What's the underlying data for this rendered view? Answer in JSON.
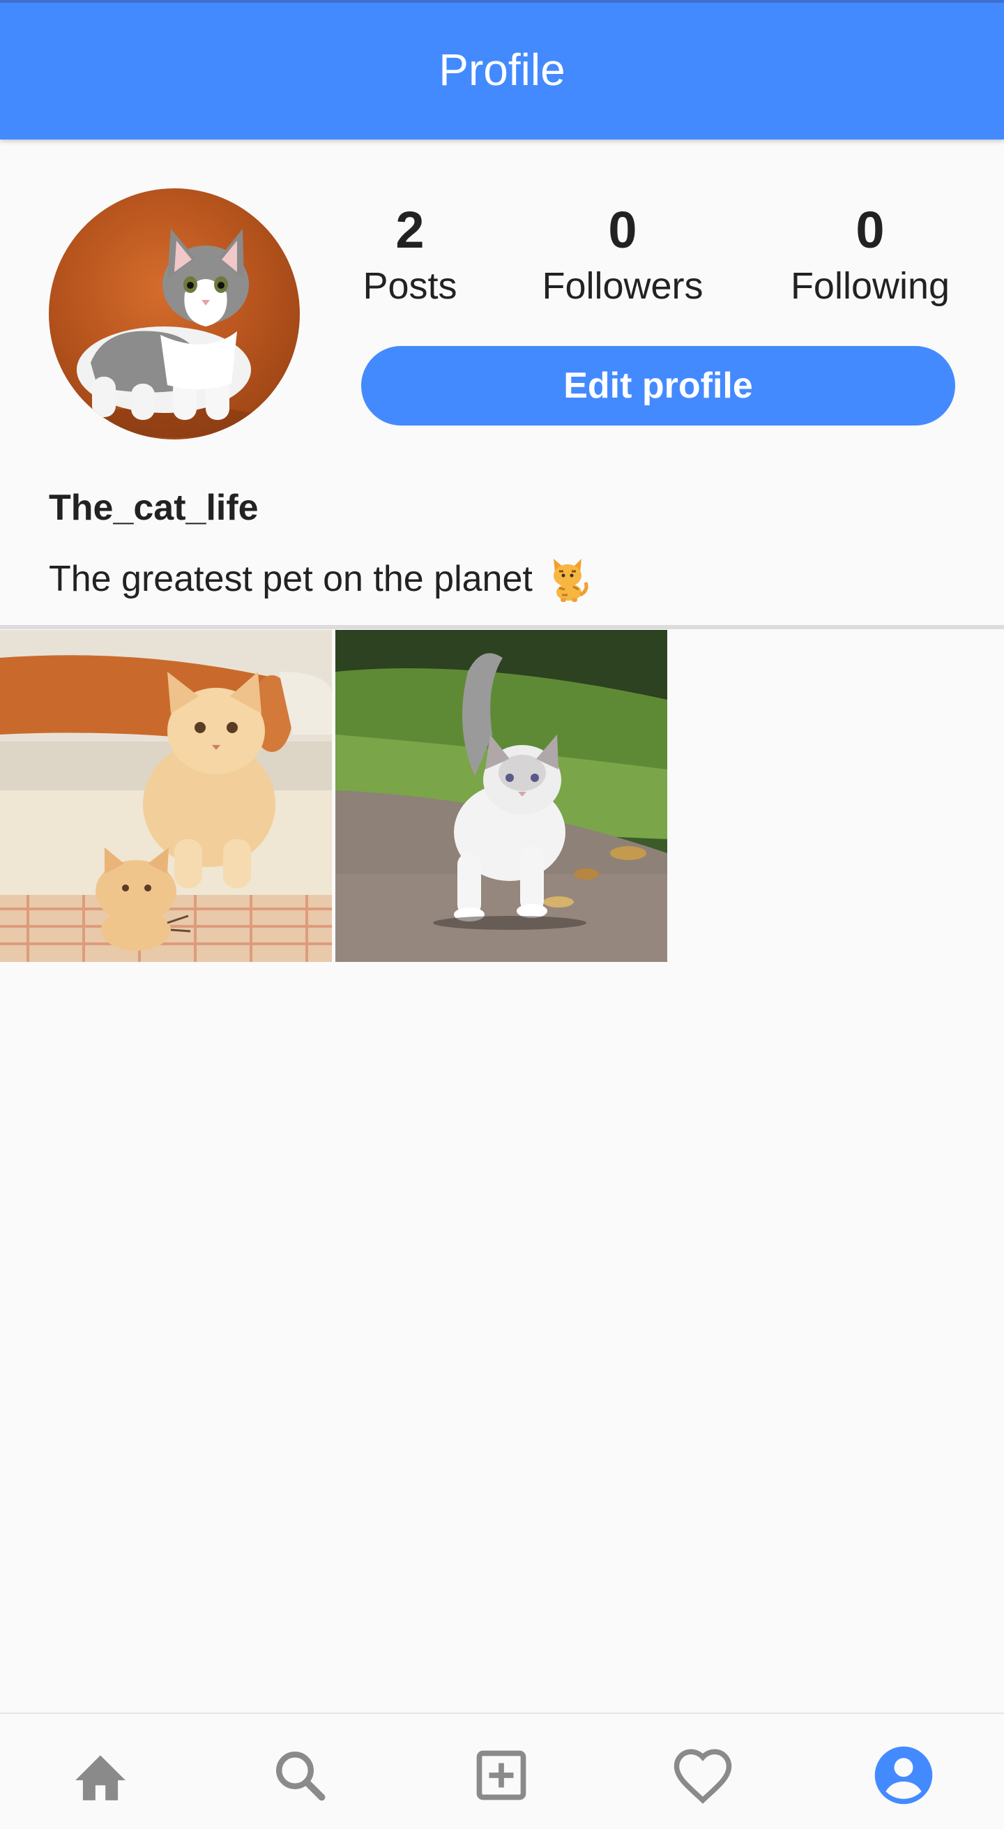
{
  "app_bar": {
    "title": "Profile"
  },
  "profile": {
    "avatar_icon": "cat-avatar-photo",
    "stats": [
      {
        "value": "2",
        "label": "Posts"
      },
      {
        "value": "0",
        "label": "Followers"
      },
      {
        "value": "0",
        "label": "Following"
      }
    ],
    "edit_button_label": "Edit profile",
    "username": "The_cat_life",
    "bio": "The greatest pet on the planet",
    "bio_emoji": "cat-emoji"
  },
  "posts": [
    {
      "icon": "two-kittens-photo"
    },
    {
      "icon": "white-kitten-walking-photo"
    }
  ],
  "bottom_nav": {
    "items": [
      "home-icon",
      "search-icon",
      "add-post-icon",
      "heart-icon",
      "profile-icon"
    ],
    "active": "profile-icon"
  },
  "colors": {
    "primary": "#448aff",
    "inactive_icon": "#8a8a8a",
    "background": "#fafafa"
  }
}
